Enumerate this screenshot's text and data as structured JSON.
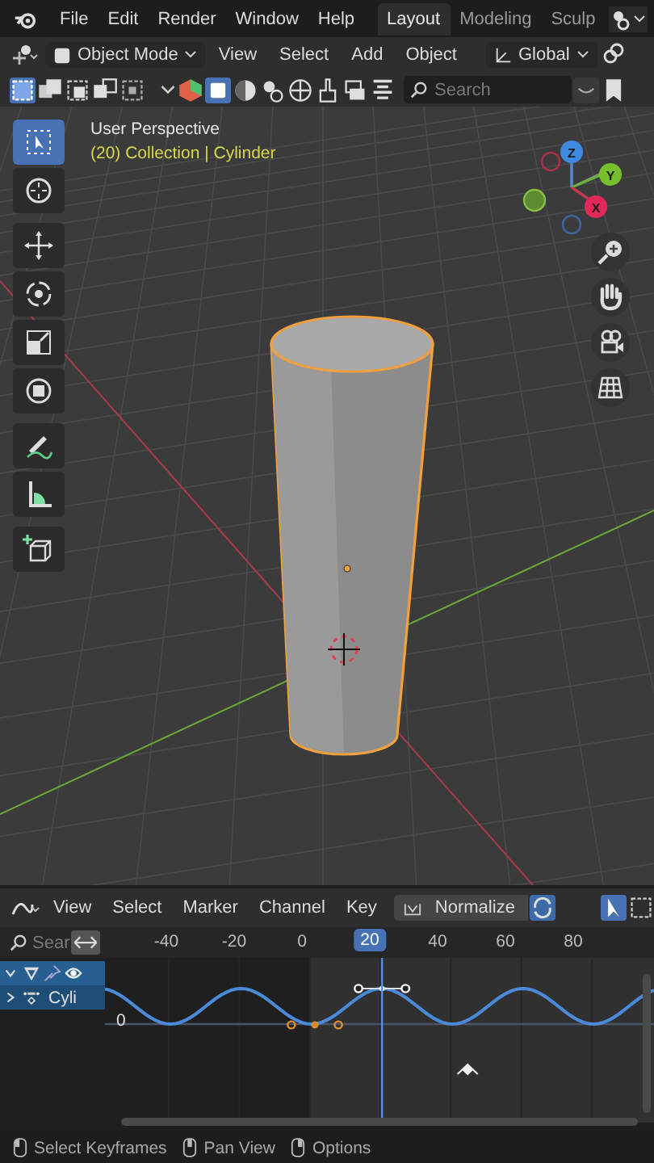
{
  "menu_bar": {
    "items": [
      "File",
      "Edit",
      "Render",
      "Window",
      "Help"
    ],
    "workspaces": [
      {
        "label": "Layout",
        "selected": true
      },
      {
        "label": "Modeling",
        "selected": false
      },
      {
        "label": "Sculp",
        "selected": false
      }
    ]
  },
  "viewport_header": {
    "mode": "Object Mode",
    "menus": [
      "View",
      "Select",
      "Add",
      "Object"
    ],
    "orientation": "Global"
  },
  "viewport_subheader": {
    "search": {
      "placeholder": "Search"
    }
  },
  "tools": [
    {
      "kind": "select",
      "selected": true
    },
    {
      "kind": "cursor",
      "selected": false
    },
    {
      "kind": "move",
      "selected": false
    },
    {
      "kind": "rotate",
      "selected": false
    },
    {
      "kind": "scale",
      "selected": false
    },
    {
      "kind": "transform",
      "selected": false
    },
    {
      "kind": "annotate",
      "selected": false
    },
    {
      "kind": "measure",
      "selected": false
    },
    {
      "kind": "add",
      "selected": false
    }
  ],
  "viewport": {
    "view_name": "User Perspective",
    "object_info": "(20) Collection | Cylinder",
    "gizmo": {
      "z": "Z",
      "y": "Y",
      "x": "X"
    }
  },
  "graph_header": {
    "menus": [
      "View",
      "Select",
      "Marker",
      "Channel",
      "Key"
    ],
    "normalize": {
      "label": "Normalize",
      "on": false
    }
  },
  "timeline": {
    "search": {
      "placeholder": "Sear"
    },
    "frames": [
      {
        "label": "-40",
        "selected": false
      },
      {
        "label": "-20",
        "selected": false
      },
      {
        "label": "0",
        "selected": false
      },
      {
        "label": "20",
        "selected": true
      },
      {
        "label": "40",
        "selected": false
      },
      {
        "label": "60",
        "selected": false
      },
      {
        "label": "80",
        "selected": false
      }
    ]
  },
  "channels": [
    {
      "kind": "object",
      "expanded": true,
      "selected": true
    },
    {
      "kind": "action",
      "label": "Cyli",
      "expanded": false,
      "selected": true
    }
  ],
  "graph": {
    "zero_label": "0"
  },
  "status_bar": [
    "Select Keyframes",
    "Pan View",
    "Options"
  ]
}
